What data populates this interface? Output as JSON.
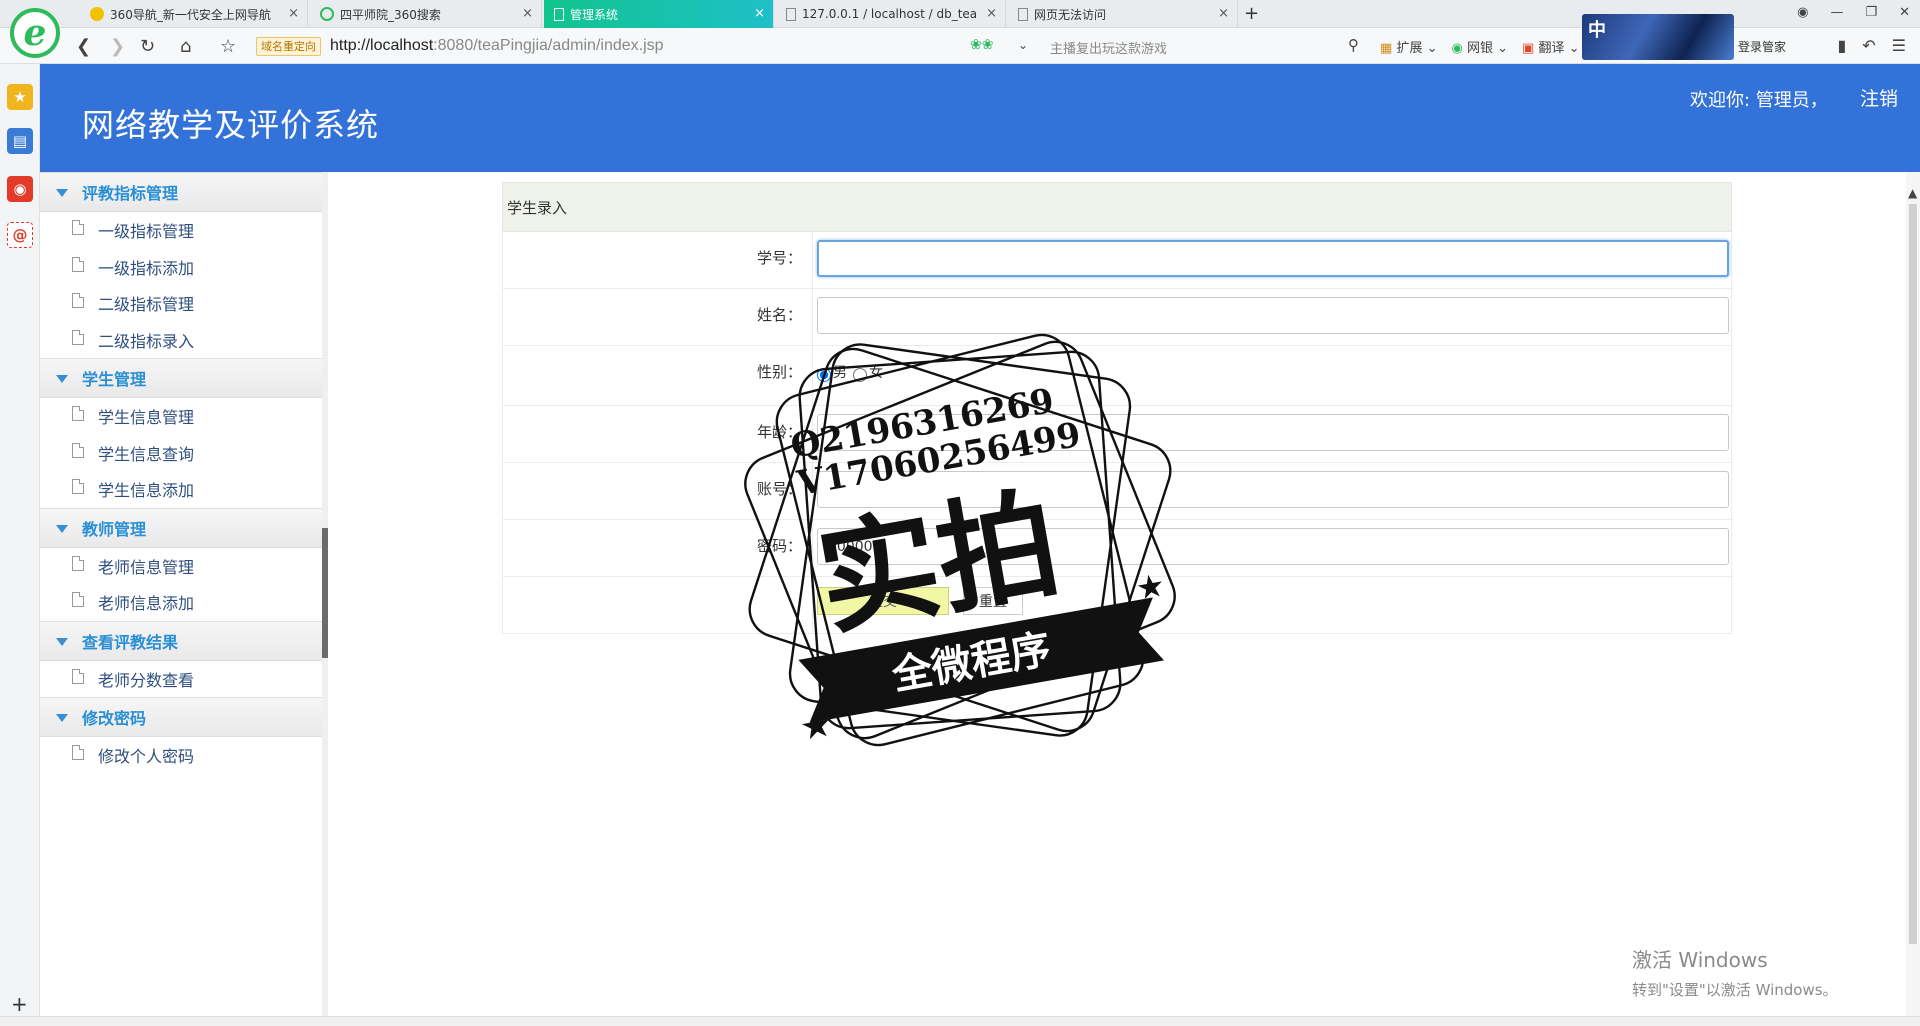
{
  "browser": {
    "tabs": [
      {
        "title": "360导航_新一代安全上网导航",
        "active": false
      },
      {
        "title": "四平师院_360搜索",
        "active": false
      },
      {
        "title": "管理系统",
        "active": true
      },
      {
        "title": "127.0.0.1 / localhost / db_tea",
        "active": false
      },
      {
        "title": "网页无法访问",
        "active": false
      }
    ],
    "close_glyph": "×",
    "new_tab_glyph": "+",
    "redirect_badge": "域名重定向",
    "url_host": "http://localhost",
    "url_rest": ":8080/teaPingjia/admin/index.jsp",
    "search_hint": "主播复出玩这款游戏",
    "toolbar": [
      "扩展",
      "网银",
      "翻译"
    ],
    "skin_char": "中",
    "login_manager": "登录管家"
  },
  "app": {
    "title": "网络教学及评价系统",
    "welcome": "欢迎你: 管理员，",
    "logout": "注销",
    "accent": "#3272d9"
  },
  "menu": {
    "groups": [
      {
        "title": "评教指标管理",
        "items": [
          "一级指标管理",
          "一级指标添加",
          "二级指标管理",
          "二级指标录入"
        ]
      },
      {
        "title": "学生管理",
        "items": [
          "学生信息管理",
          "学生信息查询",
          "学生信息添加"
        ]
      },
      {
        "title": "教师管理",
        "items": [
          "老师信息管理",
          "老师信息添加"
        ]
      },
      {
        "title": "查看评教结果",
        "items": [
          "老师分数查看"
        ]
      },
      {
        "title": "修改密码",
        "items": [
          "修改个人密码"
        ]
      }
    ]
  },
  "form": {
    "title": "学生录入",
    "fields": {
      "student_no": {
        "label": "学号：",
        "value": ""
      },
      "name": {
        "label": "姓名：",
        "value": ""
      },
      "gender": {
        "label": "性别：",
        "options": [
          "男",
          "女"
        ],
        "selected": "男"
      },
      "age": {
        "label": "年龄：",
        "value": ""
      },
      "account": {
        "label": "账号：",
        "value": ""
      },
      "password": {
        "label": "密码：",
        "value": "000000"
      }
    },
    "submit": "提交",
    "reset": "重置"
  },
  "watermark": {
    "line1": "Q2196316269",
    "line2": "V17060256499",
    "main": "实拍",
    "banner": "全微程序"
  },
  "os": {
    "activate_title": "激活 Windows",
    "activate_hint": "转到\"设置\"以激活 Windows。"
  }
}
